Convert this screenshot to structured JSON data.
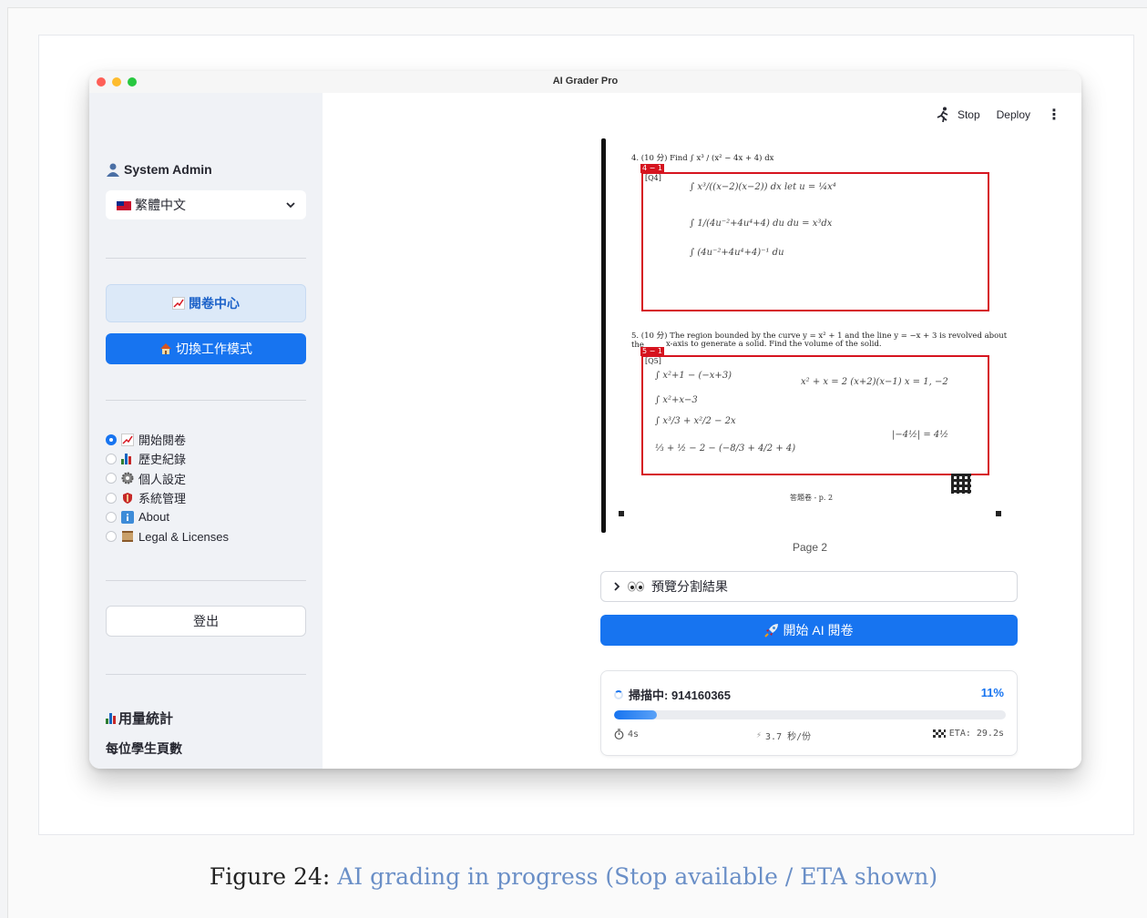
{
  "window": {
    "title": "AI Grader Pro"
  },
  "sidebar": {
    "user_name": "System Admin",
    "language": "繁體中文",
    "nav_active": "閱卷中心",
    "nav_switch": "切換工作模式",
    "radio_items": [
      {
        "label": "開始閱卷",
        "icon": "chart-up-icon",
        "checked": true
      },
      {
        "label": "歷史紀錄",
        "icon": "bar-chart-icon",
        "checked": false
      },
      {
        "label": "個人設定",
        "icon": "gear-icon",
        "checked": false
      },
      {
        "label": "系統管理",
        "icon": "shield-icon",
        "checked": false
      },
      {
        "label": "About",
        "icon": "info-icon",
        "checked": false
      },
      {
        "label": "Legal & Licenses",
        "icon": "scroll-icon",
        "checked": false
      }
    ],
    "logout": "登出",
    "usage_title": "用量統計",
    "usage_sub": "每位學生頁數"
  },
  "topbar": {
    "stop": "Stop",
    "deploy": "Deploy"
  },
  "scan": {
    "q4_text": "4. (10 分) Find ∫ x³ / (x² − 4x + 4) dx",
    "q4_tag": "4 − 1",
    "q4_label": "[Q4]",
    "q5_text_line1": "5. (10 分) The region bounded by the curve y = x² + 1 and the line y = −x + 3 is revolved about the",
    "q5_text_line2": "x-axis to generate a solid. Find the volume of the solid.",
    "q5_tag": "5 − 1",
    "q5_label": "[Q5]",
    "footer": "答題卷 - p. 2",
    "handwriting_q4": [
      "∫ x³/((x−2)(x−2)) dx   let u = ¼x⁴",
      "∫ 1/(4u⁻²+4u⁴+4) du      du = x³dx",
      "∫ (4u⁻²+4u⁴+4)⁻¹ du"
    ],
    "handwriting_q5": [
      "∫ x²+1 − (−x+3)",
      "∫ x²+x−3",
      "∫ x³/3 + x²/2 − 2x",
      "⅓ + ½ − 2 − (−8/3 + 4/2 + 4)",
      "x² + x = 2   (x+2)(x−1)   x = 1, −2",
      "|−4½| = 4½"
    ]
  },
  "page_label": "Page 2",
  "expander_label": "預覽分割結果",
  "start_button": "開始 AI 閱卷",
  "progress": {
    "status": "掃描中: 914160365",
    "percent_text": "11%",
    "percent": 0.11,
    "elapsed": "4s",
    "speed": "3.7 秒/份",
    "eta": "ETA: 29.2s"
  },
  "caption": {
    "label": "Figure 24:",
    "text": "AI grading in progress (Stop available / ETA shown)"
  },
  "colors": {
    "accent": "#1774f0",
    "danger": "#d6141f",
    "sidebar_bg": "#f0f2f6"
  }
}
